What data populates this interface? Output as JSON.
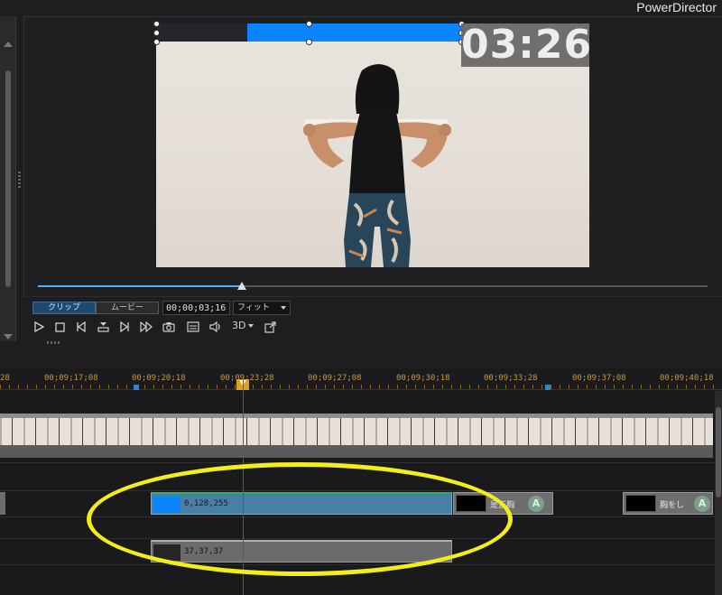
{
  "app": {
    "title": "PowerDirector"
  },
  "preview": {
    "timer_text": "03:26",
    "progress_fraction": 0.7,
    "scrub_fraction": 0.305
  },
  "controls": {
    "tab_clip": "クリップ",
    "tab_movie": "ムービー",
    "timecode": "00;00;03;16",
    "fit_label": "フィット",
    "three_d_label": "3D",
    "icons": [
      "play-icon",
      "stop-icon",
      "prev-frame-icon",
      "split-icon",
      "next-frame-icon",
      "fast-forward-icon",
      "snapshot-icon",
      "subtitle-icon",
      "volume-icon",
      "3d-icon",
      "undock-icon"
    ]
  },
  "timeline": {
    "ruler_labels": [
      "28",
      "00;09;17;08",
      "00;09;20;18",
      "00;09;23;28",
      "00;09;27;08",
      "00;09;30;18",
      "00;09;33;28",
      "00;09;37;08",
      "00;09;40;18"
    ],
    "clips": [
      {
        "label": "0,128,255",
        "thumb_color": "#0a84ff"
      },
      {
        "label": "是正胸"
      },
      {
        "label": "胸をし"
      },
      {
        "label": "37,37,37",
        "thumb_color": "#262626"
      }
    ]
  },
  "colors": {
    "accent_blue": "#0a84ff",
    "playhead": "#c42b2b",
    "annotation_highlight": "#f3ee18"
  }
}
